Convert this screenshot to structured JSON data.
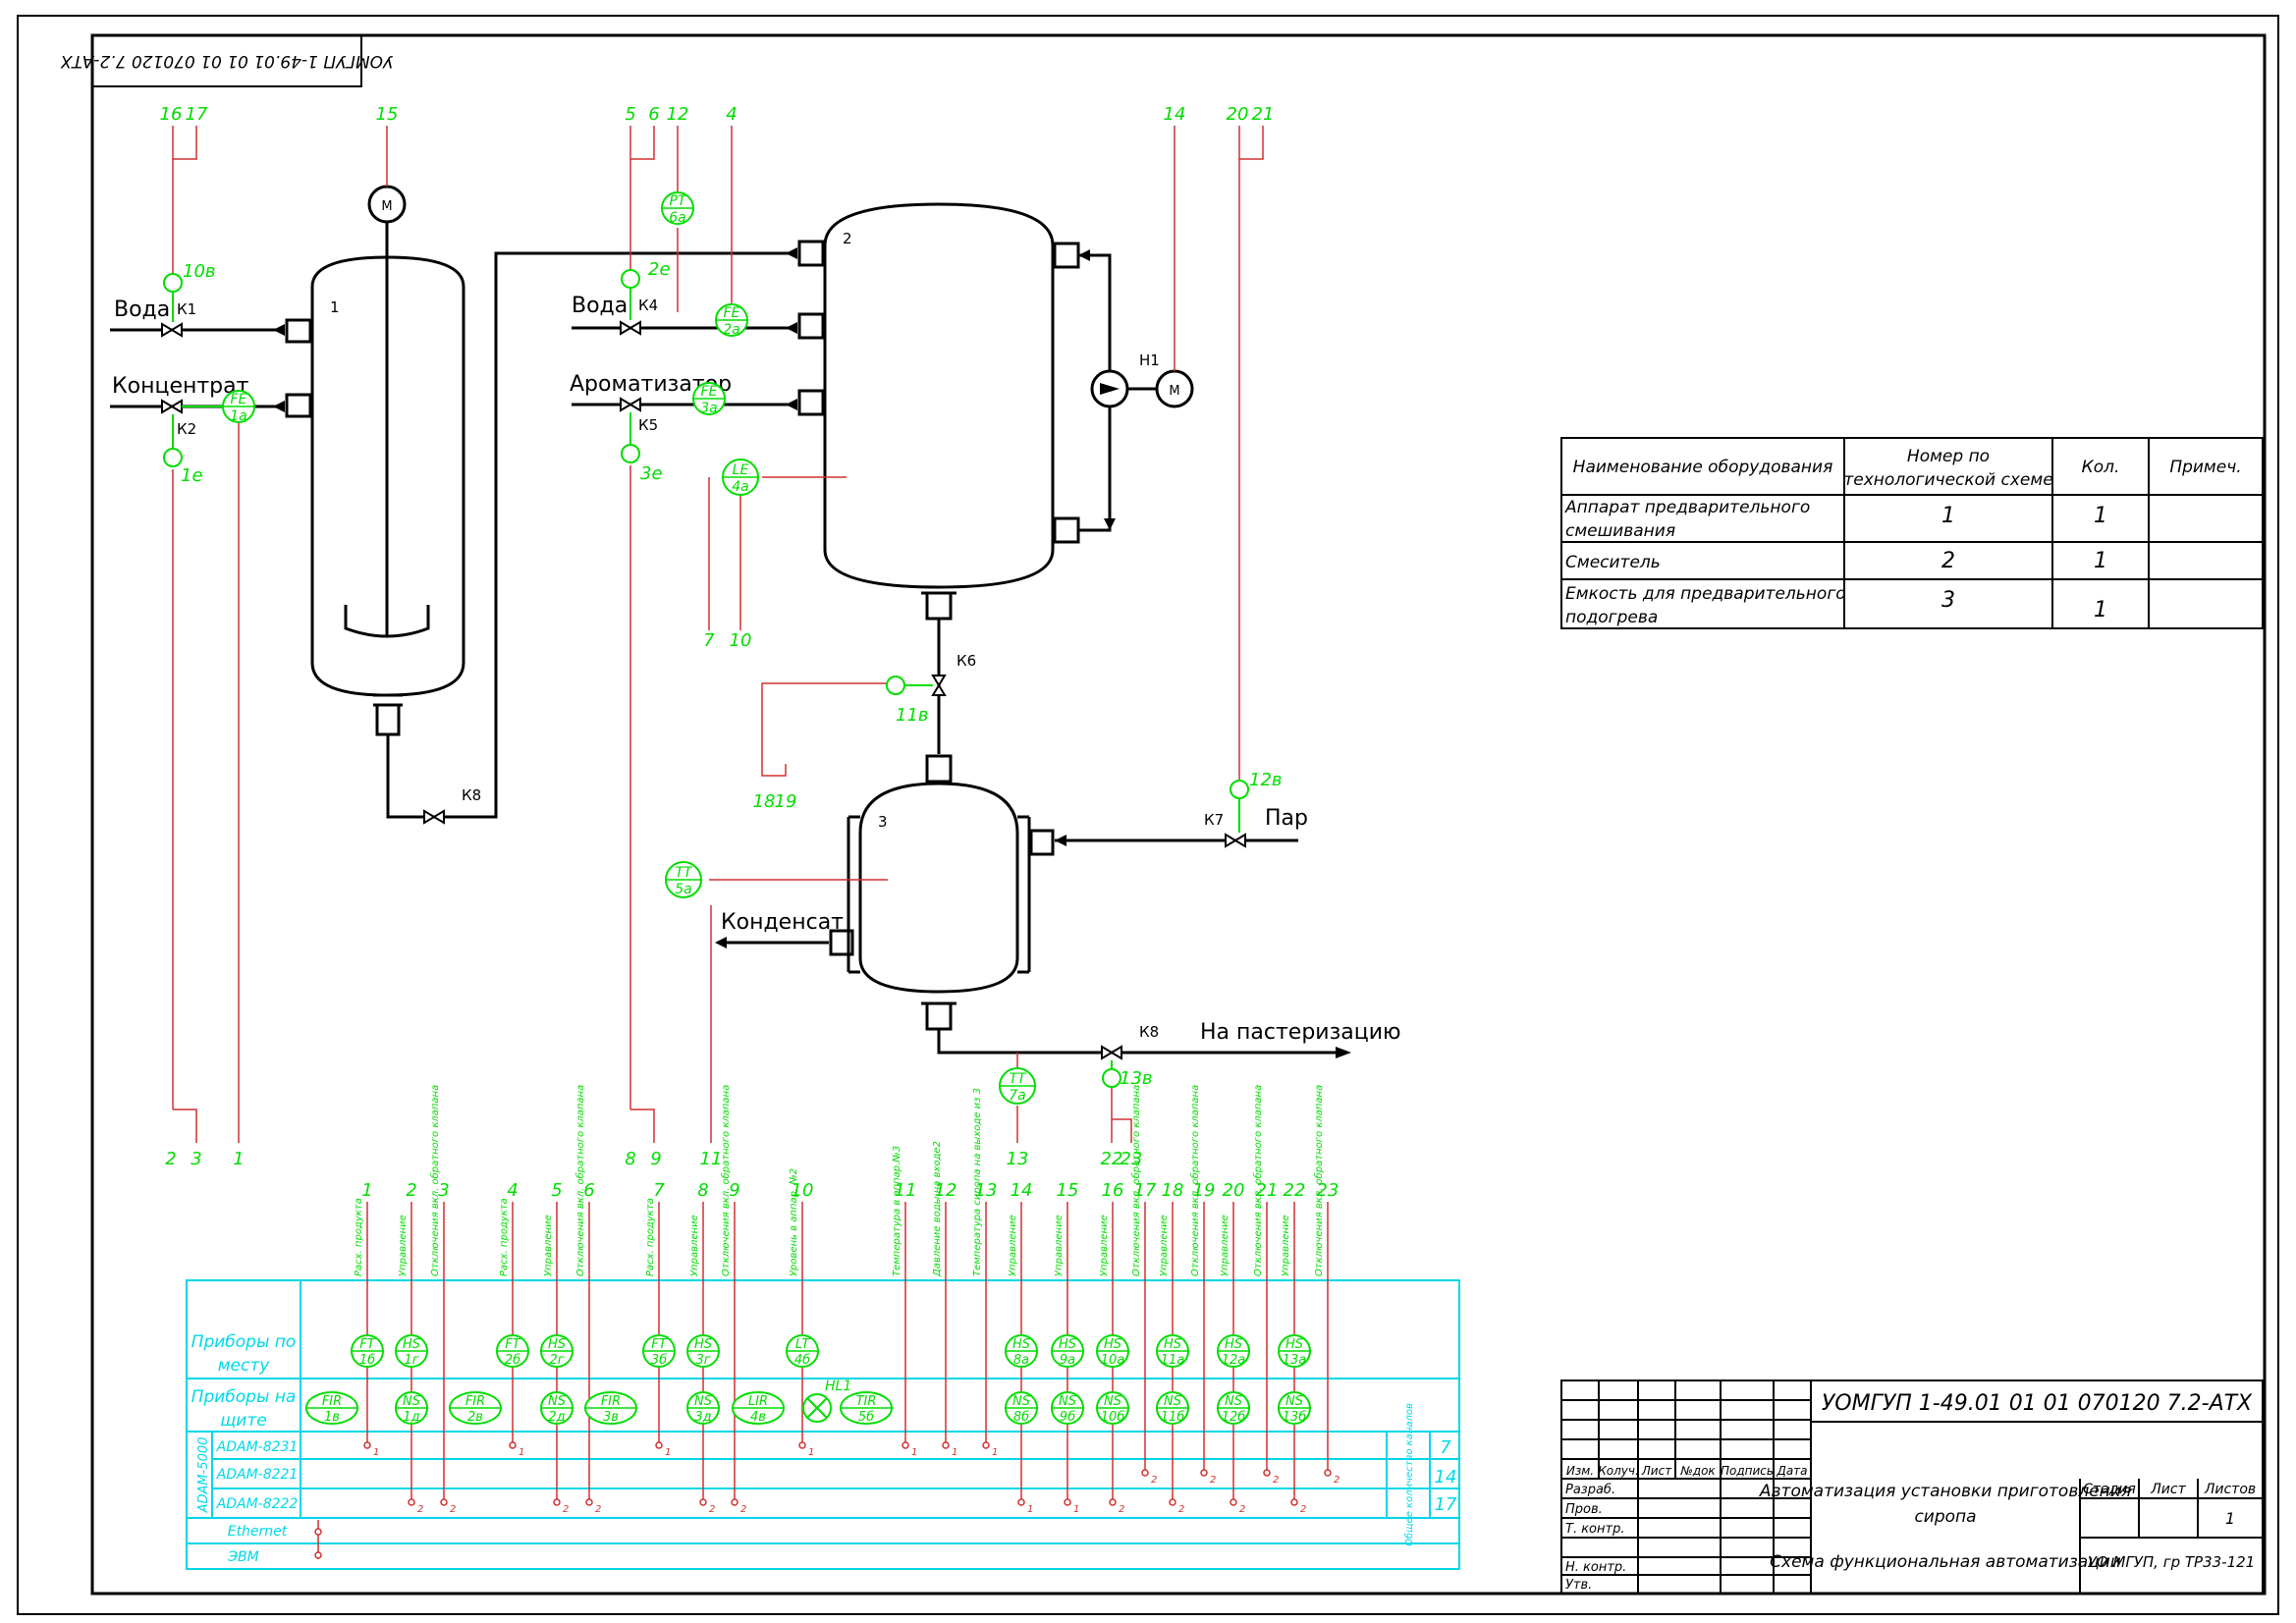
{
  "stamp_mirrored": "УОМГУП 1-49.01 01 01 070120 7.2-АТХ",
  "media": {
    "water": "Вода",
    "concentrate": "Концентрат",
    "flavor": "Ароматизатор",
    "steam": "Пар",
    "condensate": "Конденсат",
    "to_pasteurization": "На пастеризацию"
  },
  "equipment_labels": {
    "app1": "1",
    "app2": "2",
    "app3": "3"
  },
  "valves": {
    "k1": "К1",
    "k2": "К2",
    "k4": "К4",
    "k5": "К5",
    "k6": "К6",
    "k7": "К7",
    "k8a": "К8",
    "k8b": "К8",
    "h1": "Н1"
  },
  "motor_symbol": "М",
  "instruments": {
    "fe1a": [
      "FE",
      "1а"
    ],
    "fe2a": [
      "FE",
      "2а"
    ],
    "fe3a": [
      "FE",
      "3а"
    ],
    "pt6a": [
      "PT",
      "6а"
    ],
    "le4a": [
      "LE",
      "4а"
    ],
    "tt5a": [
      "TT",
      "5а"
    ],
    "tt7a": [
      "TT",
      "7а"
    ],
    "v10v": "10в",
    "v1e": "1е",
    "v2e": "2е",
    "v3e": "3е",
    "v11v": "11в",
    "v12v": "12в",
    "v13v": "13в"
  },
  "line_numbers": {
    "top_1617": [
      "16",
      "17"
    ],
    "top_15": "15",
    "top_56": [
      "5",
      "6"
    ],
    "top_12": "12",
    "top_4": "4",
    "top_14": "14",
    "top_2021": [
      "20",
      "21"
    ],
    "bot_23": [
      "2",
      "3"
    ],
    "bot_1": "1",
    "bot_89": [
      "8",
      "9"
    ],
    "bot_11": "11",
    "bot_7": "7",
    "bot_10": "10",
    "bot_1819": [
      "18",
      "19"
    ],
    "bot_13": "13",
    "bot_2223": [
      "22",
      "23"
    ]
  },
  "columns": [
    {
      "num": "1",
      "caption": "Расх. продукта"
    },
    {
      "num": "2",
      "caption": "Управление"
    },
    {
      "num": "3",
      "caption": "Отключения вкл. обратного клапана"
    },
    {
      "num": "4",
      "caption": "Расх. продукта"
    },
    {
      "num": "5",
      "caption": "Управление"
    },
    {
      "num": "6",
      "caption": "Отключения вкл. обратного клапана"
    },
    {
      "num": "7",
      "caption": "Расх. продукта"
    },
    {
      "num": "8",
      "caption": "Управление"
    },
    {
      "num": "9",
      "caption": "Отключения вкл. обратного клапана"
    },
    {
      "num": "10",
      "caption": "Уровень в аппар. №2"
    },
    {
      "num": "11",
      "caption": "Температура в аппар.№3"
    },
    {
      "num": "12",
      "caption": "Давление воды на входе2"
    },
    {
      "num": "13",
      "caption": "Температура сиропа на выходе из 3"
    },
    {
      "num": "14",
      "caption": "Управление"
    },
    {
      "num": "15",
      "caption": "Управление"
    },
    {
      "num": "16",
      "caption": "Управление"
    },
    {
      "num": "17",
      "caption": "Отключения вкл. обратного клапана"
    },
    {
      "num": "18",
      "caption": "Управление"
    },
    {
      "num": "19",
      "caption": "Отключения вкл. обратного клапана"
    },
    {
      "num": "20",
      "caption": "Управление"
    },
    {
      "num": "21",
      "caption": "Отключения вкл. обратного клапана"
    },
    {
      "num": "22",
      "caption": "Управление"
    },
    {
      "num": "23",
      "caption": "Отключения вкл. обратного клапана"
    }
  ],
  "rows": {
    "local": "Приборы по месту",
    "panel": "Приборы на щите",
    "adam": "ADAM-5000",
    "adam4231": "ADAM-8231",
    "adam4221": "ADAM-8221",
    "adam4222": "ADAM-8222",
    "ethernet": "Ethernet",
    "pc": "ЭВМ",
    "total": "Общее количество каналов",
    "counts": [
      "7",
      "14",
      "17"
    ]
  },
  "local_instruments": [
    [
      "FT",
      "1б"
    ],
    [
      "HS",
      "1г"
    ],
    [
      "FT",
      "2б"
    ],
    [
      "HS",
      "2г"
    ],
    [
      "FT",
      "3б"
    ],
    [
      "HS",
      "3г"
    ],
    [
      "LT",
      "4б"
    ],
    [
      "HS",
      "8а"
    ],
    [
      "HS",
      "9а"
    ],
    [
      "HS",
      "10а"
    ],
    [
      "HS",
      "11а"
    ],
    [
      "HS",
      "12а"
    ],
    [
      "HS",
      "13а"
    ]
  ],
  "panel_instruments": [
    [
      "FIR",
      "1в"
    ],
    [
      "NS",
      "1д"
    ],
    [
      "FIR",
      "2в"
    ],
    [
      "NS",
      "2д"
    ],
    [
      "FIR",
      "3в"
    ],
    [
      "NS",
      "3д"
    ],
    [
      "LIR",
      "4в"
    ],
    [
      "TIR",
      "5б"
    ],
    [
      "NS",
      "8б"
    ],
    [
      "NS",
      "9б"
    ],
    [
      "NS",
      "10б"
    ],
    [
      "NS",
      "11б"
    ],
    [
      "NS",
      "12б"
    ],
    [
      "NS",
      "13б"
    ]
  ],
  "lamp_label": "HL1",
  "pin_labels": {
    "one": "1",
    "two": "2"
  },
  "equipment_table": {
    "headers": [
      "Наименование оборудования",
      "Номер по технологической схеме",
      "Кол.",
      "Примеч."
    ],
    "rows": [
      [
        "Аппарат предварительного смешивания",
        "1",
        "1",
        ""
      ],
      [
        "Смеситель",
        "2",
        "1",
        ""
      ],
      [
        "Емкость для предварительного подогрева",
        "3",
        "1",
        ""
      ]
    ]
  },
  "title_block": {
    "code": "УОМГУП 1-49.01 01 01 070120 7.2-АТХ",
    "cols": [
      "Изм.",
      "Колуч.",
      "Лист",
      "№док",
      "Подпись",
      "Дата"
    ],
    "roles": [
      "Разраб.",
      "Пров.",
      "Т. контр.",
      "Н. контр.",
      "Утв."
    ],
    "title": "Автоматизация установки приготовления сиропа",
    "stage": "Стадия",
    "sheet": "Лист",
    "sheets": "Листов",
    "sheets_value": "1",
    "drawing": "Схема функциональная автоматизации",
    "org": "УО МГУП, гр ТР33-121"
  },
  "colors": {
    "green": "#00dd00",
    "red": "#d03030",
    "cyan": "#00d8e8",
    "black": "#000000"
  }
}
